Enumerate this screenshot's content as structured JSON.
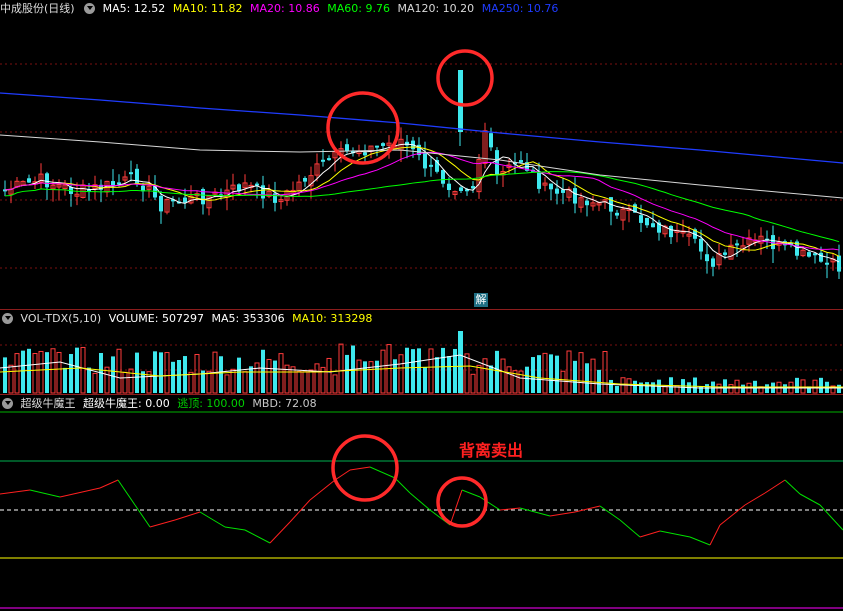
{
  "main": {
    "stock_name": "中成股份(日线)",
    "ma": [
      {
        "label": "MA5: 12.52",
        "color": "#ffffff"
      },
      {
        "label": "MA10: 11.82",
        "color": "#ffff00"
      },
      {
        "label": "MA20: 10.86",
        "color": "#ff00ff"
      },
      {
        "label": "MA60: 9.76",
        "color": "#00ff00"
      },
      {
        "label": "MA120: 10.20",
        "color": "#c8c8c8"
      },
      {
        "label": "MA250: 10.76",
        "color": "#1f3cff"
      }
    ],
    "marker": "解"
  },
  "volume": {
    "name": "VOL-TDX(5,10)",
    "items": [
      {
        "label": "VOLUME: 507297",
        "color": "#ffffff"
      },
      {
        "label": "MA5: 353306",
        "color": "#ffffff"
      },
      {
        "label": "MA10: 313298",
        "color": "#ffff00"
      }
    ]
  },
  "indicator": {
    "name": "超级牛魔王",
    "items": [
      {
        "label": "超级牛魔王: 0.00",
        "color": "#ffffff"
      },
      {
        "label": "逃顶: 100.00",
        "color": "#00d000"
      },
      {
        "label": "MBD: 72.08",
        "color": "#c8c8c8"
      }
    ],
    "annotation": "背离卖出"
  },
  "colors": {
    "up": "#ff3b3b",
    "down": "#3ee8ee",
    "ma250": "#1f3cff",
    "ma120": "#d8d8d8",
    "ma60": "#00ff00",
    "ma20": "#ff00ff",
    "ma10": "#ffff00",
    "ma5": "#ffffff"
  }
}
